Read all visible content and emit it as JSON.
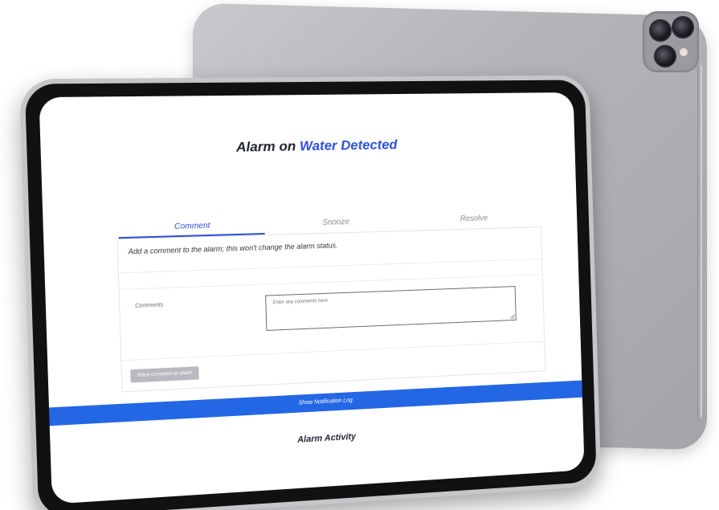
{
  "alarm": {
    "title_prefix": "Alarm on",
    "title_subject": "Water Detected"
  },
  "tabs": [
    {
      "label": "Comment",
      "active": true
    },
    {
      "label": "Snooze",
      "active": false
    },
    {
      "label": "Resolve",
      "active": false
    }
  ],
  "comment_panel": {
    "description": "Add a comment to the alarm; this won't change the alarm status.",
    "comments_label": "Comments",
    "comments_placeholder": "Enter any comments here",
    "submit_label": "Place comment on alarm"
  },
  "notification_log": {
    "label": "Show Notification Log"
  },
  "activity": {
    "title": "Alarm Activity"
  },
  "colors": {
    "accent": "#2e4fd8",
    "notification_bar": "#2467e4",
    "button_disabled": "#b9b9bf"
  }
}
